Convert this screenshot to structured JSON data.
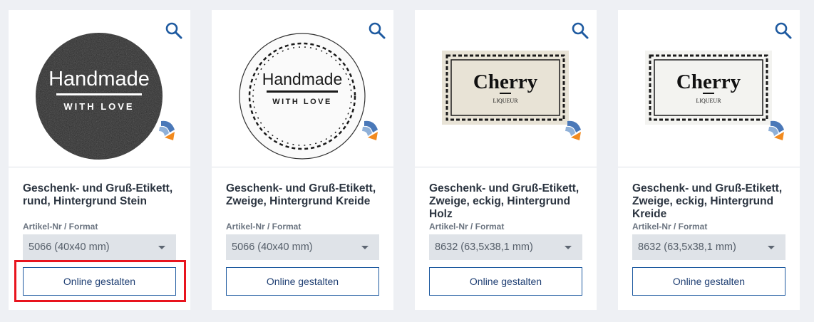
{
  "products": [
    {
      "title": "Geschenk- und Gruß-Etikett, rund, Hintergrund Stein",
      "sublabel": "Artikel-Nr / Format",
      "format": "5066 (40x40 mm)",
      "button": "Online gestalten",
      "image_text": {
        "line1": "Handmade",
        "line2": "WITH LOVE"
      }
    },
    {
      "title": "Geschenk- und Gruß-Etikett, Zweige, Hintergrund Kreide",
      "sublabel": "Artikel-Nr / Format",
      "format": "5066 (40x40 mm)",
      "button": "Online gestalten",
      "image_text": {
        "line1": "Handmade",
        "line2": "WITH LOVE"
      }
    },
    {
      "title": "Geschenk- und Gruß-Etikett, Zweige, eckig, Hintergrund Holz",
      "sublabel": "Artikel-Nr / Format",
      "format": "8632 (63,5x38,1 mm)",
      "button": "Online gestalten",
      "image_text": {
        "line1": "Cherry",
        "line2": "LIQUEUR"
      }
    },
    {
      "title": "Geschenk- und Gruß-Etikett, Zweige, eckig, Hintergrund Kreide",
      "sublabel": "Artikel-Nr / Format",
      "format": "8632 (63,5x38,1 mm)",
      "button": "Online gestalten",
      "image_text": {
        "line1": "Cherry",
        "line2": "LIQUEUR"
      }
    }
  ],
  "colors": {
    "accent": "#1e5aa0",
    "highlight": "#e8141e",
    "select_bg": "#dfe3e8",
    "page_bg": "#eef0f4"
  },
  "icons": {
    "zoom": "magnifier-icon",
    "badge": "design-online-badge-icon"
  }
}
